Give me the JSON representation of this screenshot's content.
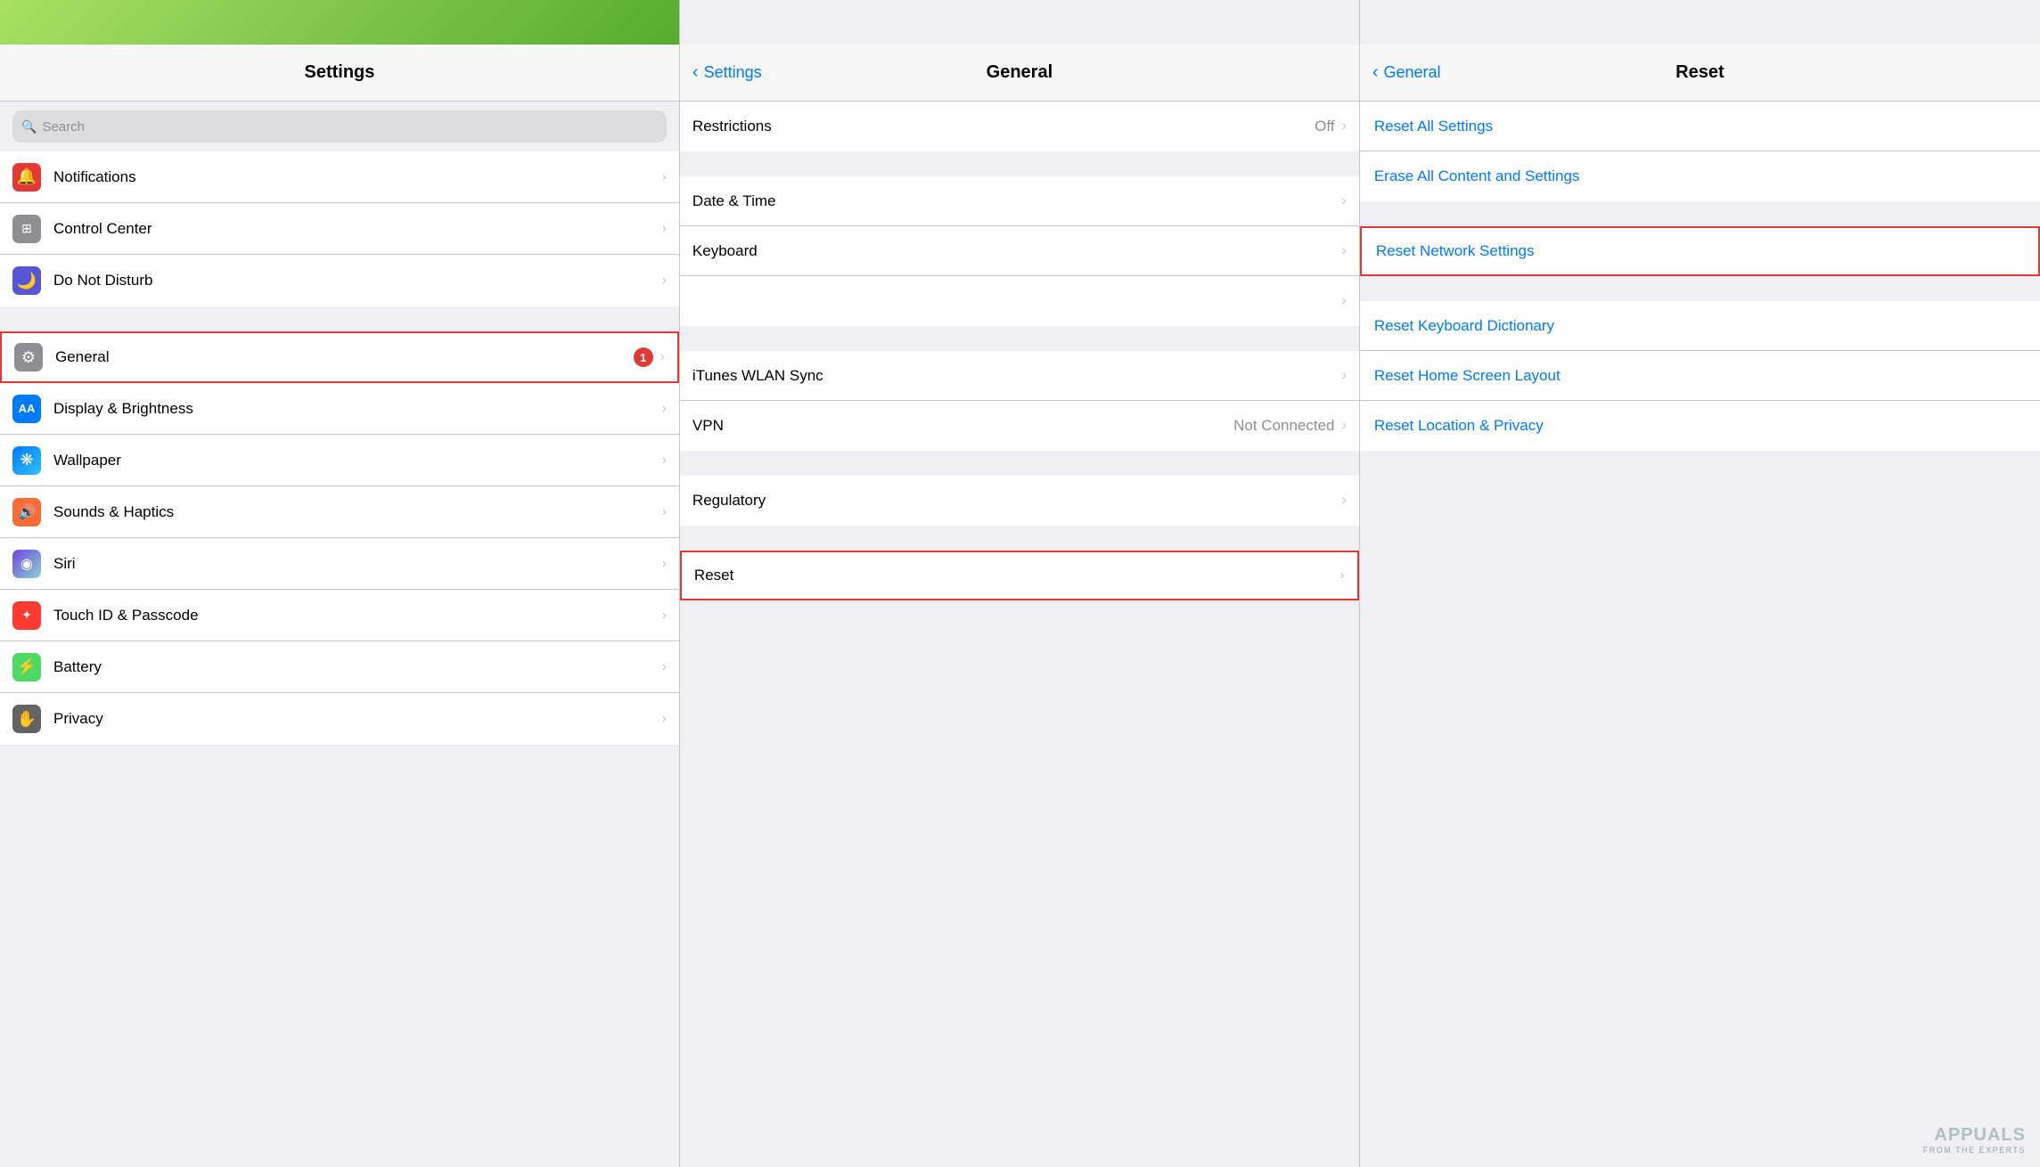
{
  "left": {
    "title": "Settings",
    "search_placeholder": "Search",
    "items_group1": [
      {
        "id": "notifications",
        "label": "Notifications",
        "icon": "🔔",
        "icon_bg": "icon-red",
        "selected": false
      },
      {
        "id": "control-center",
        "label": "Control Center",
        "icon": "⊞",
        "icon_bg": "icon-gray",
        "selected": false
      },
      {
        "id": "do-not-disturb",
        "label": "Do Not Disturb",
        "icon": "🌙",
        "icon_bg": "icon-purple",
        "selected": false
      }
    ],
    "items_group2": [
      {
        "id": "general",
        "label": "General",
        "icon": "⚙",
        "icon_bg": "icon-gray",
        "selected": true,
        "badge": "1"
      },
      {
        "id": "display-brightness",
        "label": "Display & Brightness",
        "icon": "AA",
        "icon_bg": "icon-blue-aa",
        "selected": false
      },
      {
        "id": "wallpaper",
        "label": "Wallpaper",
        "icon": "❋",
        "icon_bg": "icon-blue-flower",
        "selected": false
      },
      {
        "id": "sounds-haptics",
        "label": "Sounds & Haptics",
        "icon": "🔊",
        "icon_bg": "icon-orange-sound",
        "selected": false
      },
      {
        "id": "siri",
        "label": "Siri",
        "icon": "◉",
        "icon_bg": "icon-gray-siri",
        "selected": false
      },
      {
        "id": "touch-id-passcode",
        "label": "Touch ID & Passcode",
        "icon": "✦",
        "icon_bg": "icon-red-touch",
        "selected": false
      },
      {
        "id": "battery",
        "label": "Battery",
        "icon": "⚡",
        "icon_bg": "icon-green",
        "selected": false
      },
      {
        "id": "privacy",
        "label": "Privacy",
        "icon": "✋",
        "icon_bg": "icon-dark-gray",
        "selected": false
      }
    ]
  },
  "middle": {
    "title": "General",
    "back_label": "Settings",
    "group1": [
      {
        "id": "restrictions",
        "label": "Restrictions",
        "value": "Off",
        "has_chevron": true
      }
    ],
    "group2": [
      {
        "id": "date-time",
        "label": "Date & Time",
        "value": "",
        "has_chevron": true
      },
      {
        "id": "keyboard",
        "label": "Keyboard",
        "value": "",
        "has_chevron": true
      },
      {
        "id": "item-blank",
        "label": "",
        "value": "",
        "has_chevron": true
      }
    ],
    "group3": [
      {
        "id": "itunes-wlan",
        "label": "iTunes WLAN Sync",
        "value": "",
        "has_chevron": true
      },
      {
        "id": "vpn",
        "label": "VPN",
        "value": "Not Connected",
        "has_chevron": true
      }
    ],
    "group4": [
      {
        "id": "regulatory",
        "label": "Regulatory",
        "value": "",
        "has_chevron": true
      }
    ],
    "group5": [
      {
        "id": "reset",
        "label": "Reset",
        "value": "",
        "has_chevron": true,
        "selected": true
      }
    ]
  },
  "right": {
    "title": "Reset",
    "back_label": "General",
    "group1": [
      {
        "id": "reset-all-settings",
        "label": "Reset All Settings",
        "highlighted": false
      },
      {
        "id": "erase-all-content",
        "label": "Erase All Content and Settings",
        "highlighted": false
      }
    ],
    "group2": [
      {
        "id": "reset-network-settings",
        "label": "Reset Network Settings",
        "highlighted": true
      }
    ],
    "group3": [
      {
        "id": "reset-keyboard-dictionary",
        "label": "Reset Keyboard Dictionary",
        "highlighted": false
      },
      {
        "id": "reset-home-screen-layout",
        "label": "Reset Home Screen Layout",
        "highlighted": false
      },
      {
        "id": "reset-location-privacy",
        "label": "Reset Location & Privacy",
        "highlighted": false
      }
    ]
  },
  "watermark": {
    "main": "APPUALS",
    "sub": "FROM THE EXPERTS"
  }
}
